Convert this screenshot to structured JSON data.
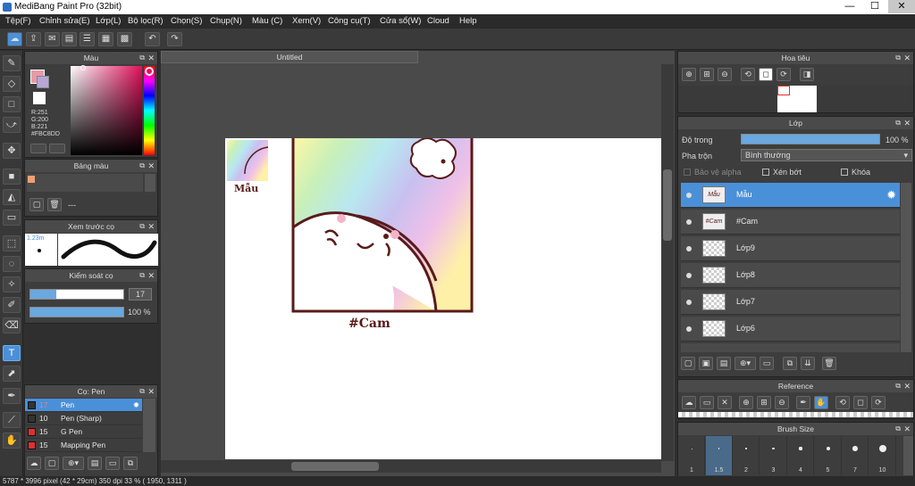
{
  "app": {
    "title": "MediBang Paint Pro (32bit)",
    "min": "—",
    "max": "☐",
    "close": "✕"
  },
  "menu": [
    "Tệp(F)",
    "Chỉnh sửa(E)",
    "Lớp(L)",
    "Bộ lọc(R)",
    "Chọn(S)",
    "Chụp(N)",
    "Màu (C)",
    "Xem(V)",
    "Công cụ(T)",
    "Cửa sổ(W)",
    "Cloud",
    "Help"
  ],
  "document": {
    "tab": "Untitled"
  },
  "color_panel": {
    "title": "Màu",
    "r": "R:251",
    "g": "G:200",
    "b": "B:221",
    "hex": "#FBC8DD",
    "fg": "#fa4f6e",
    "bg": "#e89aa8"
  },
  "palette_panel": {
    "title": "Bảng màu",
    "dash": "---",
    "swatch": "#f0a070"
  },
  "brush_preview": {
    "title": "Xem trước cọ",
    "size": "1.23m"
  },
  "brush_control": {
    "title": "Kiểm soát cọ",
    "size": "17",
    "opacity": "100 %",
    "size_level": 0.28,
    "opacity_level": 1.0
  },
  "brush_list": {
    "title": "Cọ: Pen",
    "items": [
      {
        "num": "17",
        "name": "Pen",
        "color": "#333333"
      },
      {
        "num": "10",
        "name": "Pen (Sharp)",
        "color": "#333333"
      },
      {
        "num": "15",
        "name": "G Pen",
        "color": "#e03030"
      },
      {
        "num": "15",
        "name": "Mapping Pen",
        "color": "#e03030"
      }
    ]
  },
  "navigator": {
    "title": "Hoa tiêu"
  },
  "layer_panel": {
    "title": "Lớp",
    "opacity_label": "Độ trong",
    "opacity": "100 %",
    "opacity_level": 1.0,
    "blend_label": "Pha trộn",
    "blend": "Bình thường",
    "protect_alpha": "Bảo vệ alpha",
    "clip": "Xén bớt",
    "lock": "Khóa",
    "layers": [
      {
        "name": "Mẫu",
        "thumb": "Mẫu"
      },
      {
        "name": "#Cam",
        "thumb": "#Cam"
      },
      {
        "name": "Lớp9",
        "thumb": ""
      },
      {
        "name": "Lớp8",
        "thumb": ""
      },
      {
        "name": "Lớp7",
        "thumb": ""
      },
      {
        "name": "Lớp6",
        "thumb": ""
      }
    ]
  },
  "reference": {
    "title": "Reference"
  },
  "brush_size": {
    "title": "Brush Size",
    "sizes": [
      "1",
      "1.5",
      "2",
      "3",
      "4",
      "5",
      "7",
      "10"
    ]
  },
  "canvas": {
    "sample_label": "Mẫu",
    "cam_label": "#Cam"
  },
  "status": {
    "text": "5787 * 3996 pixel   (42 * 29cm)   350 dpi   33 %   ( 1950, 1311 )"
  }
}
